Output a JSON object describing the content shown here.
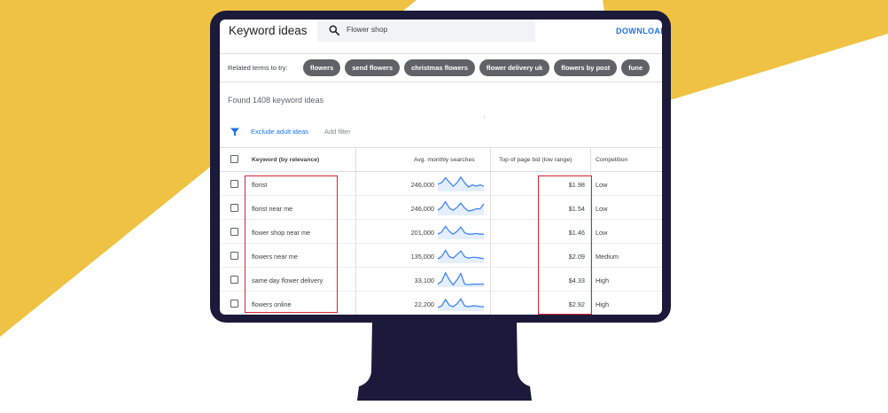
{
  "colors": {
    "background_accent": "#f0c243",
    "monitor": "#1b1a3a",
    "chip": "#5f6368",
    "link": "#1a73e8",
    "highlight": "#d9262f",
    "sparkline": "#4285f4"
  },
  "header": {
    "title": "Keyword ideas",
    "search_value": "Flower shop",
    "search_icon": "search-icon",
    "download_label": "DOWNLOAD"
  },
  "related": {
    "label": "Related terms to try:",
    "chips": [
      "flowers",
      "send flowers",
      "christmas flowers",
      "flower delivery uk",
      "flowers by post",
      "fune"
    ]
  },
  "results": {
    "found_text": "Found 1408 keyword ideas"
  },
  "filters": {
    "filter_icon": "filter-icon",
    "exclude_label": "Exclude adult ideas",
    "add_filter_label": "Add filter"
  },
  "table": {
    "columns": {
      "keyword": "Keyword (by relevance)",
      "searches": "Avg. monthly searches",
      "bid_low": "Top of page bid (low range)",
      "competition": "Competition"
    },
    "rows": [
      {
        "keyword": "florist",
        "searches": "246,000",
        "bid_low": "$1.98",
        "competition": "Low",
        "trend": [
          0.45,
          0.55,
          0.9,
          0.6,
          0.3,
          0.55,
          0.95,
          0.55,
          0.25,
          0.4,
          0.3,
          0.4,
          0.3
        ]
      },
      {
        "keyword": "florist near me",
        "searches": "246,000",
        "bid_low": "$1.54",
        "competition": "Low",
        "trend": [
          0.3,
          0.5,
          0.9,
          0.45,
          0.3,
          0.5,
          0.8,
          0.45,
          0.25,
          0.3,
          0.4,
          0.4,
          0.75
        ]
      },
      {
        "keyword": "flower shop near me",
        "searches": "201,000",
        "bid_low": "$1.46",
        "competition": "Low",
        "trend": [
          0.3,
          0.45,
          0.85,
          0.5,
          0.3,
          0.5,
          0.8,
          0.4,
          0.3,
          0.3,
          0.35,
          0.3,
          0.3
        ]
      },
      {
        "keyword": "flowers near me",
        "searches": "135,000",
        "bid_low": "$2.09",
        "competition": "Medium",
        "trend": [
          0.25,
          0.4,
          0.85,
          0.4,
          0.3,
          0.55,
          0.8,
          0.4,
          0.3,
          0.35,
          0.35,
          0.3,
          0.25
        ]
      },
      {
        "keyword": "same day flower delivery",
        "searches": "33,100",
        "bid_low": "$4.33",
        "competition": "High",
        "trend": [
          0.15,
          0.35,
          0.95,
          0.45,
          0.1,
          0.45,
          0.9,
          0.15,
          0.1,
          0.15,
          0.15,
          0.15,
          0.15
        ]
      },
      {
        "keyword": "flowers online",
        "searches": "22,200",
        "bid_low": "$2.92",
        "competition": "High",
        "trend": [
          0.2,
          0.3,
          0.75,
          0.35,
          0.25,
          0.45,
          0.8,
          0.3,
          0.25,
          0.3,
          0.3,
          0.25,
          0.25
        ]
      }
    ]
  }
}
